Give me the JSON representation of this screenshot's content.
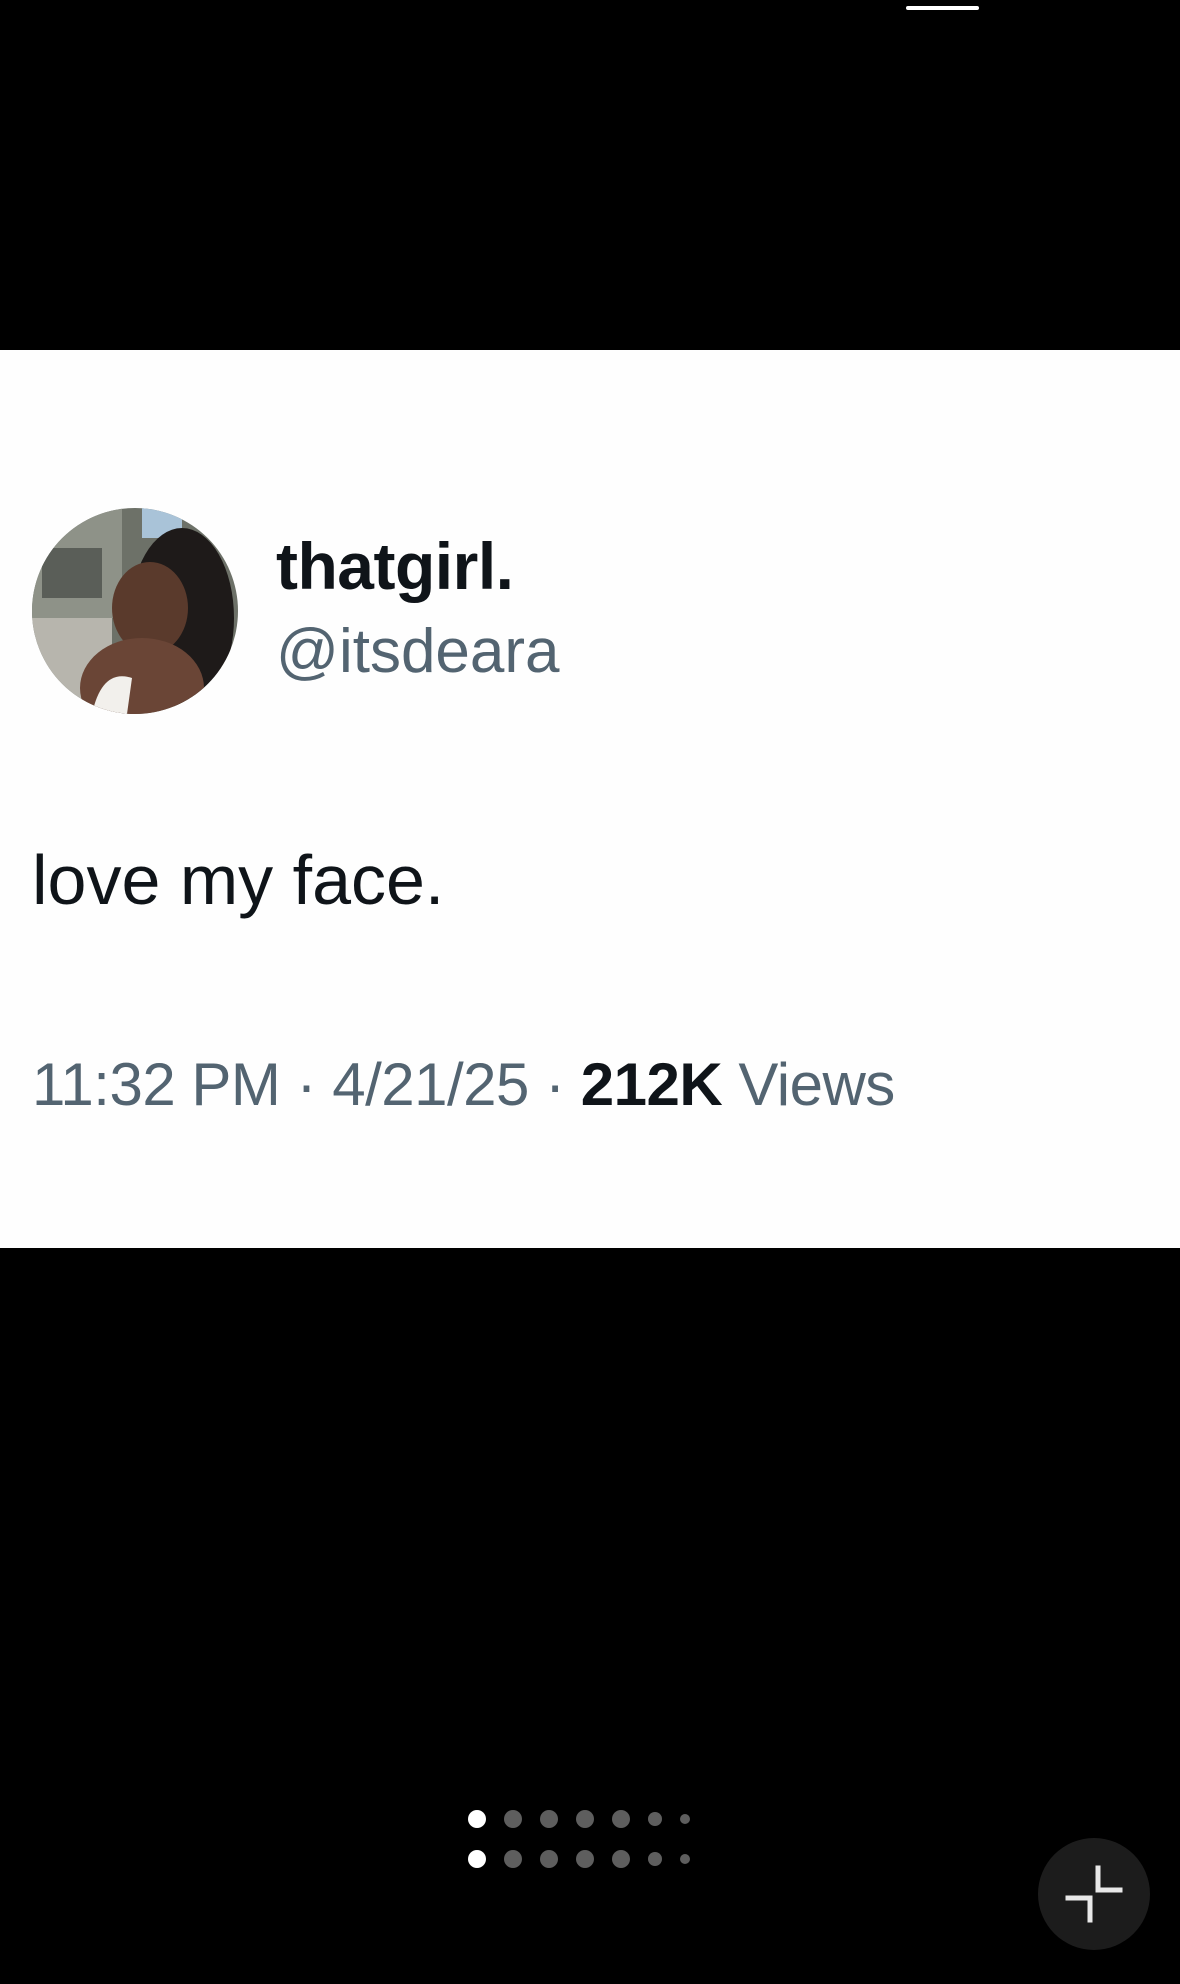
{
  "tweet": {
    "display_name": "thatgirl.",
    "handle": "@itsdeara",
    "text": "love my face.",
    "time": "11:32 PM",
    "separator": "·",
    "date": "4/21/25",
    "views_count": "212K",
    "views_label": "Views"
  },
  "pager": {
    "page_count": 7,
    "active_index": 0
  },
  "icons": {
    "avatar": "profile-photo",
    "collapse": "collapse-arrows-icon"
  },
  "colors": {
    "background": "#000000",
    "card": "#fefefe",
    "primary_text": "#0f1419",
    "secondary_text": "#536471"
  }
}
